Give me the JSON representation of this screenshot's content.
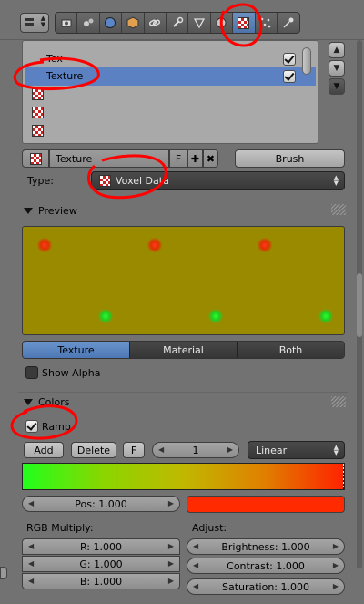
{
  "colors": {
    "selection": "#5b81c2",
    "active_tab": "#4d78b5",
    "annotation_red": "#ff0000",
    "preview_bg": "#9a8a00",
    "ramp_start": "#22ff1c",
    "ramp_end": "#ff2200"
  },
  "context_tabs": [
    "render-icon",
    "scene-icon",
    "world-icon",
    "object-icon",
    "constraints-icon",
    "modifiers-icon",
    "data-icon",
    "material-icon",
    "texture-icon",
    "particles-icon",
    "physics-icon"
  ],
  "texture_slots": {
    "items": [
      {
        "label": "Tex",
        "checked": true
      },
      {
        "label": "Texture",
        "checked": true,
        "selected": true
      },
      {
        "label": ""
      },
      {
        "label": ""
      },
      {
        "label": ""
      }
    ]
  },
  "datablock": {
    "name": "Texture",
    "fake_user": "F",
    "brush_label": "Brush"
  },
  "type_field": {
    "label": "Type:",
    "value": "Voxel Data"
  },
  "preview_panel": {
    "title": "Preview",
    "tabs": [
      "Texture",
      "Material",
      "Both"
    ],
    "active_tab": "Texture",
    "show_alpha": "Show Alpha"
  },
  "colors_panel": {
    "title": "Colors",
    "ramp_label": "Ramp",
    "add": "Add",
    "delete": "Delete",
    "flip": "F",
    "index": "1",
    "interpolation": "Linear",
    "pos": "Pos: 1.000",
    "rgb_multiply_label": "RGB Multiply:",
    "r": "R: 1.000",
    "g": "G: 1.000",
    "b": "B: 1.000",
    "adjust_label": "Adjust:",
    "brightness": "Brightness: 1.000",
    "contrast": "Contrast: 1.000",
    "saturation": "Saturation: 1.000"
  }
}
